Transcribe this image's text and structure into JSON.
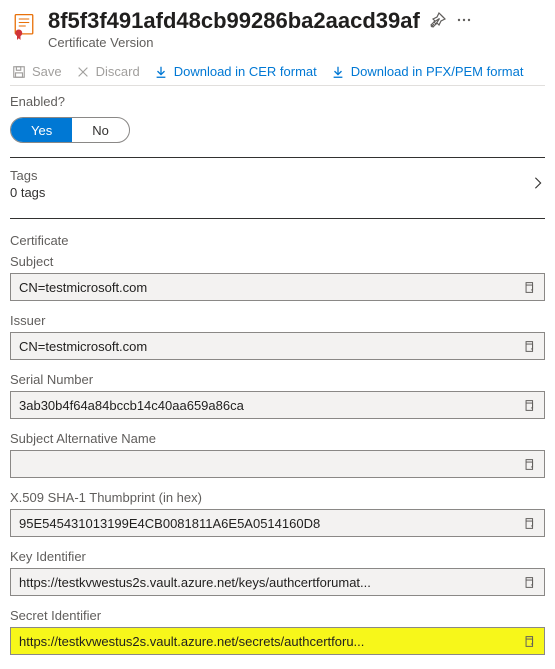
{
  "header": {
    "title": "8f5f3f491afd48cb99286ba2aacd39af",
    "subtitle": "Certificate Version"
  },
  "toolbar": {
    "save": "Save",
    "discard": "Discard",
    "download_cer": "Download in CER format",
    "download_pfx": "Download in PFX/PEM format"
  },
  "enabled": {
    "label": "Enabled?",
    "yes": "Yes",
    "no": "No"
  },
  "tags": {
    "label": "Tags",
    "count": "0 tags"
  },
  "cert_section": "Certificate",
  "fields": {
    "subject": {
      "label": "Subject",
      "value": "CN=testmicrosoft.com"
    },
    "issuer": {
      "label": "Issuer",
      "value": "CN=testmicrosoft.com"
    },
    "serial": {
      "label": "Serial Number",
      "value": "3ab30b4f64a84bccb14c40aa659a86ca"
    },
    "san": {
      "label": "Subject Alternative Name",
      "value": ""
    },
    "thumb": {
      "label": "X.509 SHA-1 Thumbprint (in hex)",
      "value": "95E545431013199E4CB0081811A6E5A0514160D8"
    },
    "keyid": {
      "label": "Key Identifier",
      "value": "https://testkvwestus2s.vault.azure.net/keys/authcertforumat..."
    },
    "secretid": {
      "label": "Secret Identifier",
      "value": "https://testkvwestus2s.vault.azure.net/secrets/authcertforu..."
    }
  }
}
